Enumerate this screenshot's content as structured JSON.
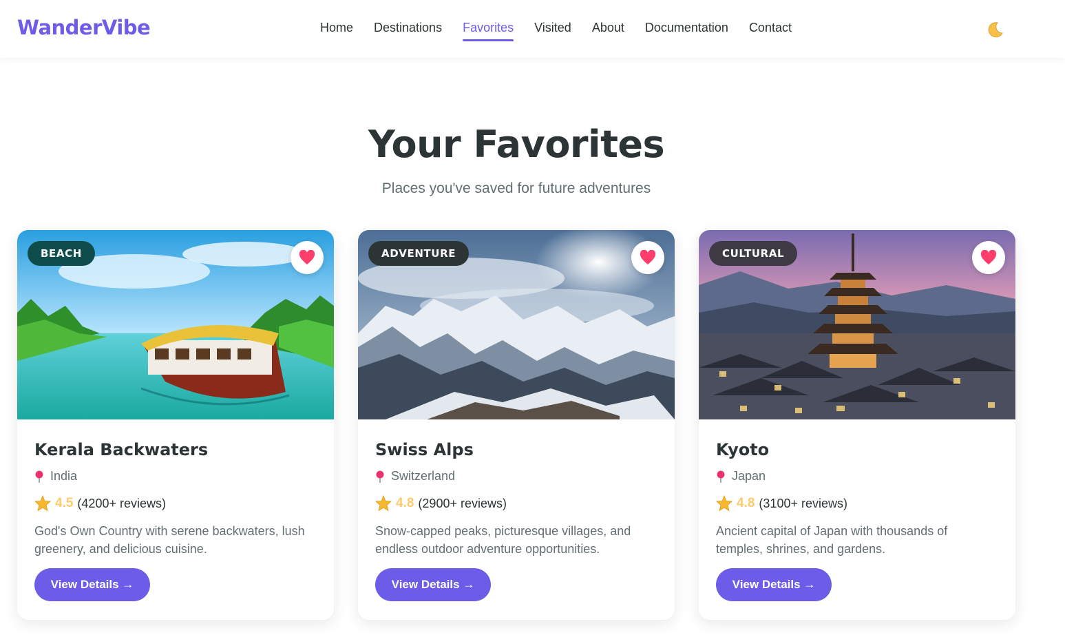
{
  "brand": {
    "name": "WanderVibe",
    "accent": "#6c5ce7"
  },
  "nav": {
    "items": [
      {
        "label": "Home",
        "active": false
      },
      {
        "label": "Destinations",
        "active": false
      },
      {
        "label": "Favorites",
        "active": true
      },
      {
        "label": "Visited",
        "active": false
      },
      {
        "label": "About",
        "active": false
      },
      {
        "label": "Documentation",
        "active": false
      },
      {
        "label": "Contact",
        "active": false
      }
    ],
    "theme_toggle_icon": "moon-icon"
  },
  "hero": {
    "title": "Your Favorites",
    "subtitle": "Places you've saved for future adventures"
  },
  "cards": [
    {
      "category": "BEACH",
      "category_color": "#0f4c4c",
      "image": "houseboat-on-backwaters",
      "favorited": true,
      "title": "Kerala Backwaters",
      "location": "India",
      "rating": "4.5",
      "reviews": "(4200+ reviews)",
      "description": "God's Own Country with serene backwaters, lush greenery, and delicious cuisine.",
      "button": "View Details →"
    },
    {
      "category": "ADVENTURE",
      "category_color": "#2d3436",
      "image": "snowy-mountain-range",
      "favorited": true,
      "title": "Swiss Alps",
      "location": "Switzerland",
      "rating": "4.8",
      "reviews": "(2900+ reviews)",
      "description": "Snow-capped peaks, picturesque villages, and endless outdoor adventure opportunities.",
      "button": "View Details →"
    },
    {
      "category": "CULTURAL",
      "category_color": "#3d3a44",
      "image": "pagoda-over-old-town",
      "favorited": true,
      "title": "Kyoto",
      "location": "Japan",
      "rating": "4.8",
      "reviews": "(3100+ reviews)",
      "description": "Ancient capital of Japan with thousands of temples, shrines, and gardens.",
      "button": "View Details →"
    }
  ]
}
